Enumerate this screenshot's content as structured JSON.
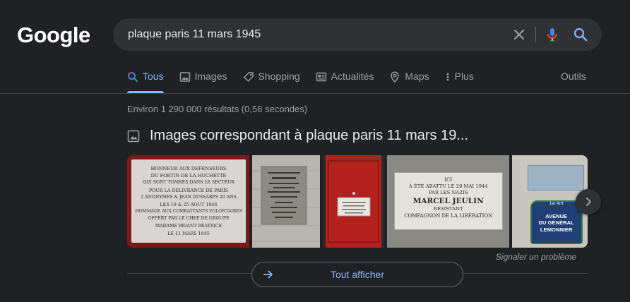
{
  "header": {
    "logo_text": "Google",
    "search": {
      "value": "plaque paris 11 mars 1945"
    }
  },
  "tabs": [
    {
      "label": "Tous",
      "icon": "search-icon",
      "active": true
    },
    {
      "label": "Images",
      "icon": "image-icon"
    },
    {
      "label": "Shopping",
      "icon": "tag-icon"
    },
    {
      "label": "Actualités",
      "icon": "news-icon"
    },
    {
      "label": "Maps",
      "icon": "map-pin-icon"
    },
    {
      "label": "Plus",
      "icon": "more-vert-icon"
    }
  ],
  "tools_label": "Outils",
  "result_stats": "Environ 1 290 000 résultats (0,56 secondes)",
  "images_section": {
    "title": "Images correspondant à plaque paris 11 mars 19...",
    "plaque1": [
      "HONNEUR AUX DEFENSEURS",
      "DU FORTIN DE LA HUCHETTE",
      "QUI SONT TOMBÉS DANS LE SECTEUR",
      "POUR LA DÉLIVRANCE DE PARIS",
      "2 ANONYMES & JEAN DUSSARPS 20 ANS",
      "LES 19 & 25 AOUT 1944",
      "HOMMAGE AUX COMBATTANTS VOLONTAIRES",
      "OFFERT PAR LE CHEF DE GROUPE",
      "MADAME BRIANT BEATRICE",
      "LE 11 MARS 1945"
    ],
    "plaque2": [
      "ICI",
      "A ÉTÉ ABATTU LE 20 MAI 1944",
      "PAR LES NAZIS",
      "MARCEL JEULIN",
      "RÉSISTANT",
      "COMPAGNON DE LA LIBÉRATION"
    ],
    "plaque3": [
      "1er Arrt",
      "AVENUE",
      "DU GÉNÉRAL",
      "LEMONNIER"
    ],
    "report_label": "Signaler un problème",
    "show_all_label": "Tout afficher"
  },
  "colors": {
    "background": "#202124",
    "accent": "#8ab4f8",
    "muted": "#9aa0a6"
  }
}
